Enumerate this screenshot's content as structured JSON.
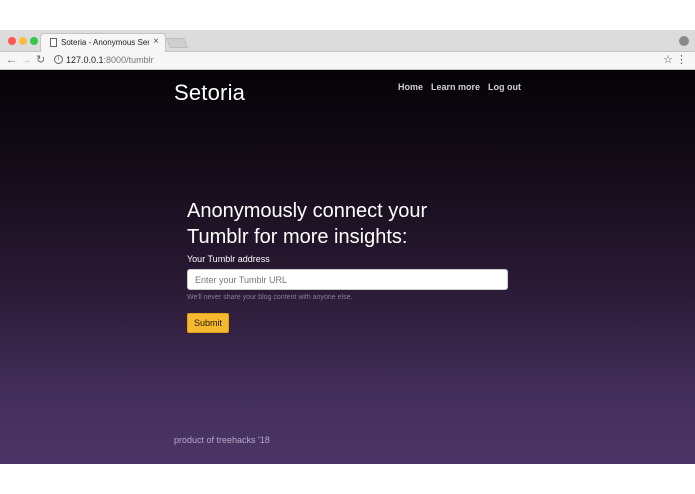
{
  "browser": {
    "tab_title": "Soteria - Anonymous Sentime",
    "tab_close": "×",
    "url_host": "127.0.0.1",
    "url_path": ":8000/tumblr",
    "icons": [
      "back-icon",
      "forward-icon",
      "reload-icon",
      "info-icon",
      "star-icon",
      "more-icon",
      "profile-icon"
    ]
  },
  "header": {
    "brand": "Setoria",
    "nav": [
      "Home",
      "Learn more",
      "Log out"
    ]
  },
  "form": {
    "heading": "Anonymously connect your Tumblr for more insights:",
    "label": "Your Tumblr address",
    "input_placeholder": "Enter your Tumblr URL",
    "input_value": "",
    "help": "We'll never share your blog content with anyone else.",
    "submit": "Submit"
  },
  "footer": {
    "text": "product of treehacks '18"
  },
  "colors": {
    "accent": "#f5b82e",
    "gradient_top": "#050307",
    "gradient_bottom": "#4c3566"
  }
}
